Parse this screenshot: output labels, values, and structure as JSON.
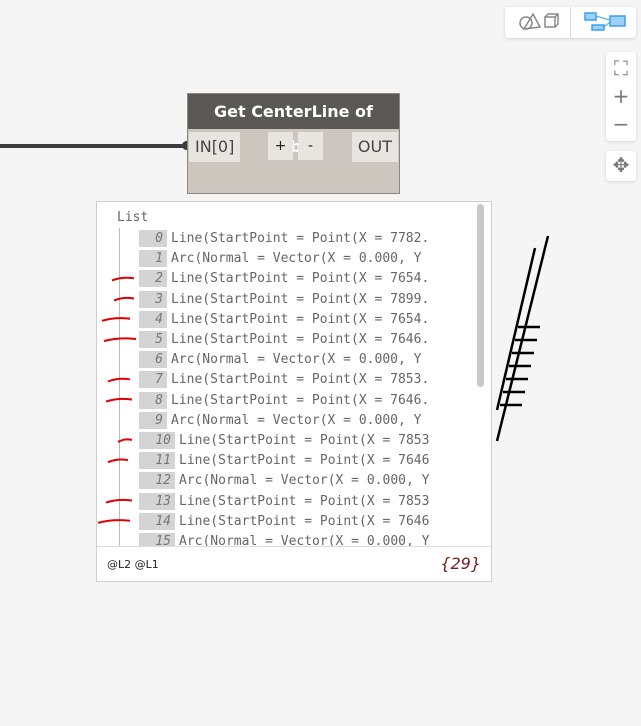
{
  "node": {
    "title": "Get CenterLine of Rebar",
    "input": "IN[0]",
    "output": "OUT",
    "add": "+",
    "remove": "-"
  },
  "preview": {
    "title": "List",
    "items": [
      {
        "index": "0",
        "text": "Line(StartPoint = Point(X = 7782."
      },
      {
        "index": "1",
        "text": "Arc(Normal = Vector(X = 0.000, Y"
      },
      {
        "index": "2",
        "text": "Line(StartPoint = Point(X = 7654."
      },
      {
        "index": "3",
        "text": "Line(StartPoint = Point(X = 7899."
      },
      {
        "index": "4",
        "text": "Line(StartPoint = Point(X = 7654."
      },
      {
        "index": "5",
        "text": "Line(StartPoint = Point(X = 7646."
      },
      {
        "index": "6",
        "text": "Arc(Normal = Vector(X = 0.000, Y"
      },
      {
        "index": "7",
        "text": "Line(StartPoint = Point(X = 7853."
      },
      {
        "index": "8",
        "text": "Line(StartPoint = Point(X = 7646."
      },
      {
        "index": "9",
        "text": "Arc(Normal = Vector(X = 0.000, Y"
      },
      {
        "index": "10",
        "text": "Line(StartPoint = Point(X = 7853"
      },
      {
        "index": "11",
        "text": "Line(StartPoint = Point(X = 7646"
      },
      {
        "index": "12",
        "text": "Arc(Normal = Vector(X = 0.000, Y"
      },
      {
        "index": "13",
        "text": "Line(StartPoint = Point(X = 7853"
      },
      {
        "index": "14",
        "text": "Line(StartPoint = Point(X = 7646"
      },
      {
        "index": "15",
        "text": "Arc(Normal = Vector(X = 0.000, Y"
      }
    ],
    "levels": "@L2 @L1",
    "count": "{29}"
  },
  "colors": {
    "accent": "#3aa0f0",
    "annotation": "#e00000"
  }
}
